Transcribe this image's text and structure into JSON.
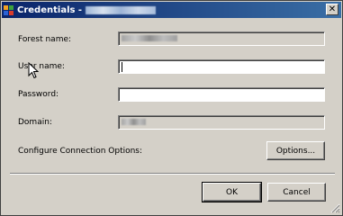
{
  "window": {
    "title": "Credentials -",
    "close_glyph": "✕"
  },
  "form": {
    "forest_name": {
      "label": "Forest name:"
    },
    "user_name": {
      "label": "User name:",
      "value": ""
    },
    "password": {
      "label": "Password:",
      "value": ""
    },
    "domain": {
      "label": "Domain:"
    },
    "connection": {
      "label": "Configure Connection Options:",
      "button": "Options..."
    }
  },
  "footer": {
    "ok": "OK",
    "cancel": "Cancel"
  },
  "icons": [
    "app-icon",
    "close-icon",
    "mouse-cursor-icon",
    "resize-grip-icon"
  ],
  "colors": {
    "dialog_bg": "#d4d0c8",
    "titlebar_start": "#0a246a",
    "titlebar_end": "#3a6ea5"
  }
}
